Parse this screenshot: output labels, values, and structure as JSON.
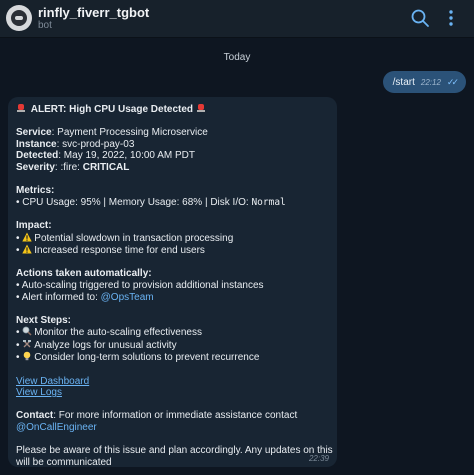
{
  "header": {
    "title": "rinfly_fiverr_tgbot",
    "subtitle": "bot",
    "icons": [
      "search-icon",
      "more-vertical-icon"
    ]
  },
  "date_separator": "Today",
  "outgoing": {
    "text": "/start",
    "time": "22:12"
  },
  "alert": {
    "title": "ALERT: High CPU Usage Detected",
    "service_label": "Service",
    "service": ": Payment Processing Microservice",
    "instance_label": "Instance",
    "instance": ": svc-prod-pay-03",
    "detected_label": "Detected",
    "detected": ": May 19, 2022, 10:00 AM PDT",
    "severity_label": "Severity",
    "severity_prefix": ": :fire: ",
    "severity": "CRITICAL",
    "metrics_heading": "Metrics:",
    "metrics_line": "• CPU Usage: 95% | Memory Usage: 68% | Disk I/O: ",
    "disk_io": "Normal",
    "impact_heading": "Impact:",
    "impact_1": "Potential slowdown in transaction processing",
    "impact_2": "Increased response time for end users",
    "actions_heading": "Actions taken automatically:",
    "action_1": "• Auto-scaling triggered to provision additional instances",
    "action_2_prefix": "• Alert informed to: ",
    "action_2_mention": "@OpsTeam",
    "next_heading": "Next Steps:",
    "next_1": "Monitor the auto-scaling effectiveness",
    "next_2": "Analyze logs for unusual activity",
    "next_3": "Consider long-term solutions to prevent recurrence",
    "link_dashboard": "View Dashboard",
    "link_logs": "View Logs",
    "contact_label": "Contact",
    "contact_text": ": For more information or immediate assistance contact",
    "contact_mention": "@OnCallEngineer",
    "footer_1": "Please be aware of this issue and plan accordingly. Any updates on this",
    "footer_2": "will be communicated",
    "time": "22:39"
  },
  "colors": {
    "background": "#0e1621",
    "header": "#17212b",
    "incoming_bubble": "#182533",
    "outgoing_bubble": "#2b5278",
    "link": "#6ab3f3"
  }
}
